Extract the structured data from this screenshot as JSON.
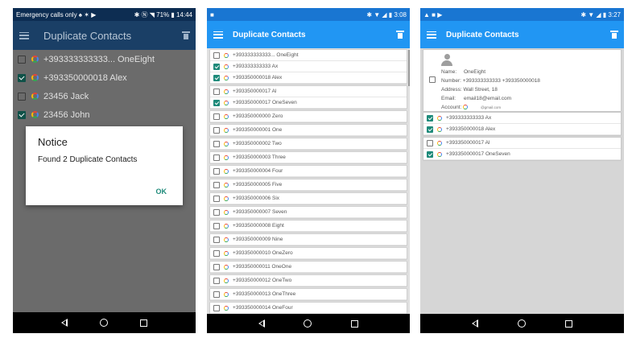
{
  "phone1": {
    "status": {
      "left": "Emergency calls only ♠ ✶ ▶",
      "right": "✱ Ⓝ ◥ 71% ▮ 14:44"
    },
    "title": "Duplicate Contacts",
    "rows": [
      {
        "text": "+393333333333... OneEight",
        "checked": false
      },
      {
        "text": "+393350000018 Alex",
        "checked": true
      },
      {
        "text": "23456 Jack",
        "checked": false
      },
      {
        "text": "23456 John",
        "checked": true
      }
    ],
    "dialog": {
      "title": "Notice",
      "message": "Found 2 Duplicate Contacts",
      "ok": "OK"
    }
  },
  "phone2": {
    "status": {
      "left": "■",
      "right": "✱ ▼ ◢ ▮ 3:08"
    },
    "title": "Duplicate Contacts",
    "groups": [
      [
        {
          "text": "+393333333333... OneEight",
          "checked": false
        },
        {
          "text": "+393333333333 Ax",
          "checked": true
        },
        {
          "text": "+393350000018 Alex",
          "checked": true
        }
      ],
      [
        {
          "text": "+393350000017 Al",
          "checked": false
        },
        {
          "text": "+393350000017 OneSeven",
          "checked": true
        }
      ],
      [
        {
          "text": "+393350000000 Zero",
          "checked": false
        }
      ],
      [
        {
          "text": "+393350000001 One",
          "checked": false
        }
      ],
      [
        {
          "text": "+393350000002 Two",
          "checked": false
        }
      ],
      [
        {
          "text": "+393350000003 Three",
          "checked": false
        }
      ],
      [
        {
          "text": "+393350000004 Four",
          "checked": false
        }
      ],
      [
        {
          "text": "+393350000005 Five",
          "checked": false
        }
      ],
      [
        {
          "text": "+393350000006 Six",
          "checked": false
        }
      ],
      [
        {
          "text": "+393350000007 Seven",
          "checked": false
        }
      ],
      [
        {
          "text": "+393350000008 Eight",
          "checked": false
        }
      ],
      [
        {
          "text": "+393350000009 Nine",
          "checked": false
        }
      ],
      [
        {
          "text": "+393350000010 OneZero",
          "checked": false
        }
      ],
      [
        {
          "text": "+393350000011 OneOne",
          "checked": false
        }
      ],
      [
        {
          "text": "+393350000012 OneTwo",
          "checked": false
        }
      ],
      [
        {
          "text": "+393350000013 OneThree",
          "checked": false
        }
      ],
      [
        {
          "text": "+393350000014 OneFour",
          "checked": false
        }
      ]
    ]
  },
  "phone3": {
    "status": {
      "left": "▲ ■ ▶",
      "right": "✱ ▼ ◢ ▮ 3:27"
    },
    "title": "Duplicate Contacts",
    "card": {
      "checked": false,
      "name_label": "Name:",
      "name": "OneEight",
      "number_label": "Number:",
      "number": "+393333333333 +393350000018",
      "address_label": "Address:",
      "address": "Wall Street, 18",
      "email_label": "Email:",
      "email": "email18@email.com",
      "account_label": "Account:",
      "account": "@gmail.com"
    },
    "group1": [
      {
        "text": "+393333333333 Ax",
        "checked": true
      },
      {
        "text": "+393350000018 Alex",
        "checked": true
      }
    ],
    "group2": [
      {
        "text": "+393350000017 Al",
        "checked": false
      },
      {
        "text": "+393350000017 OneSeven",
        "checked": true
      }
    ]
  }
}
